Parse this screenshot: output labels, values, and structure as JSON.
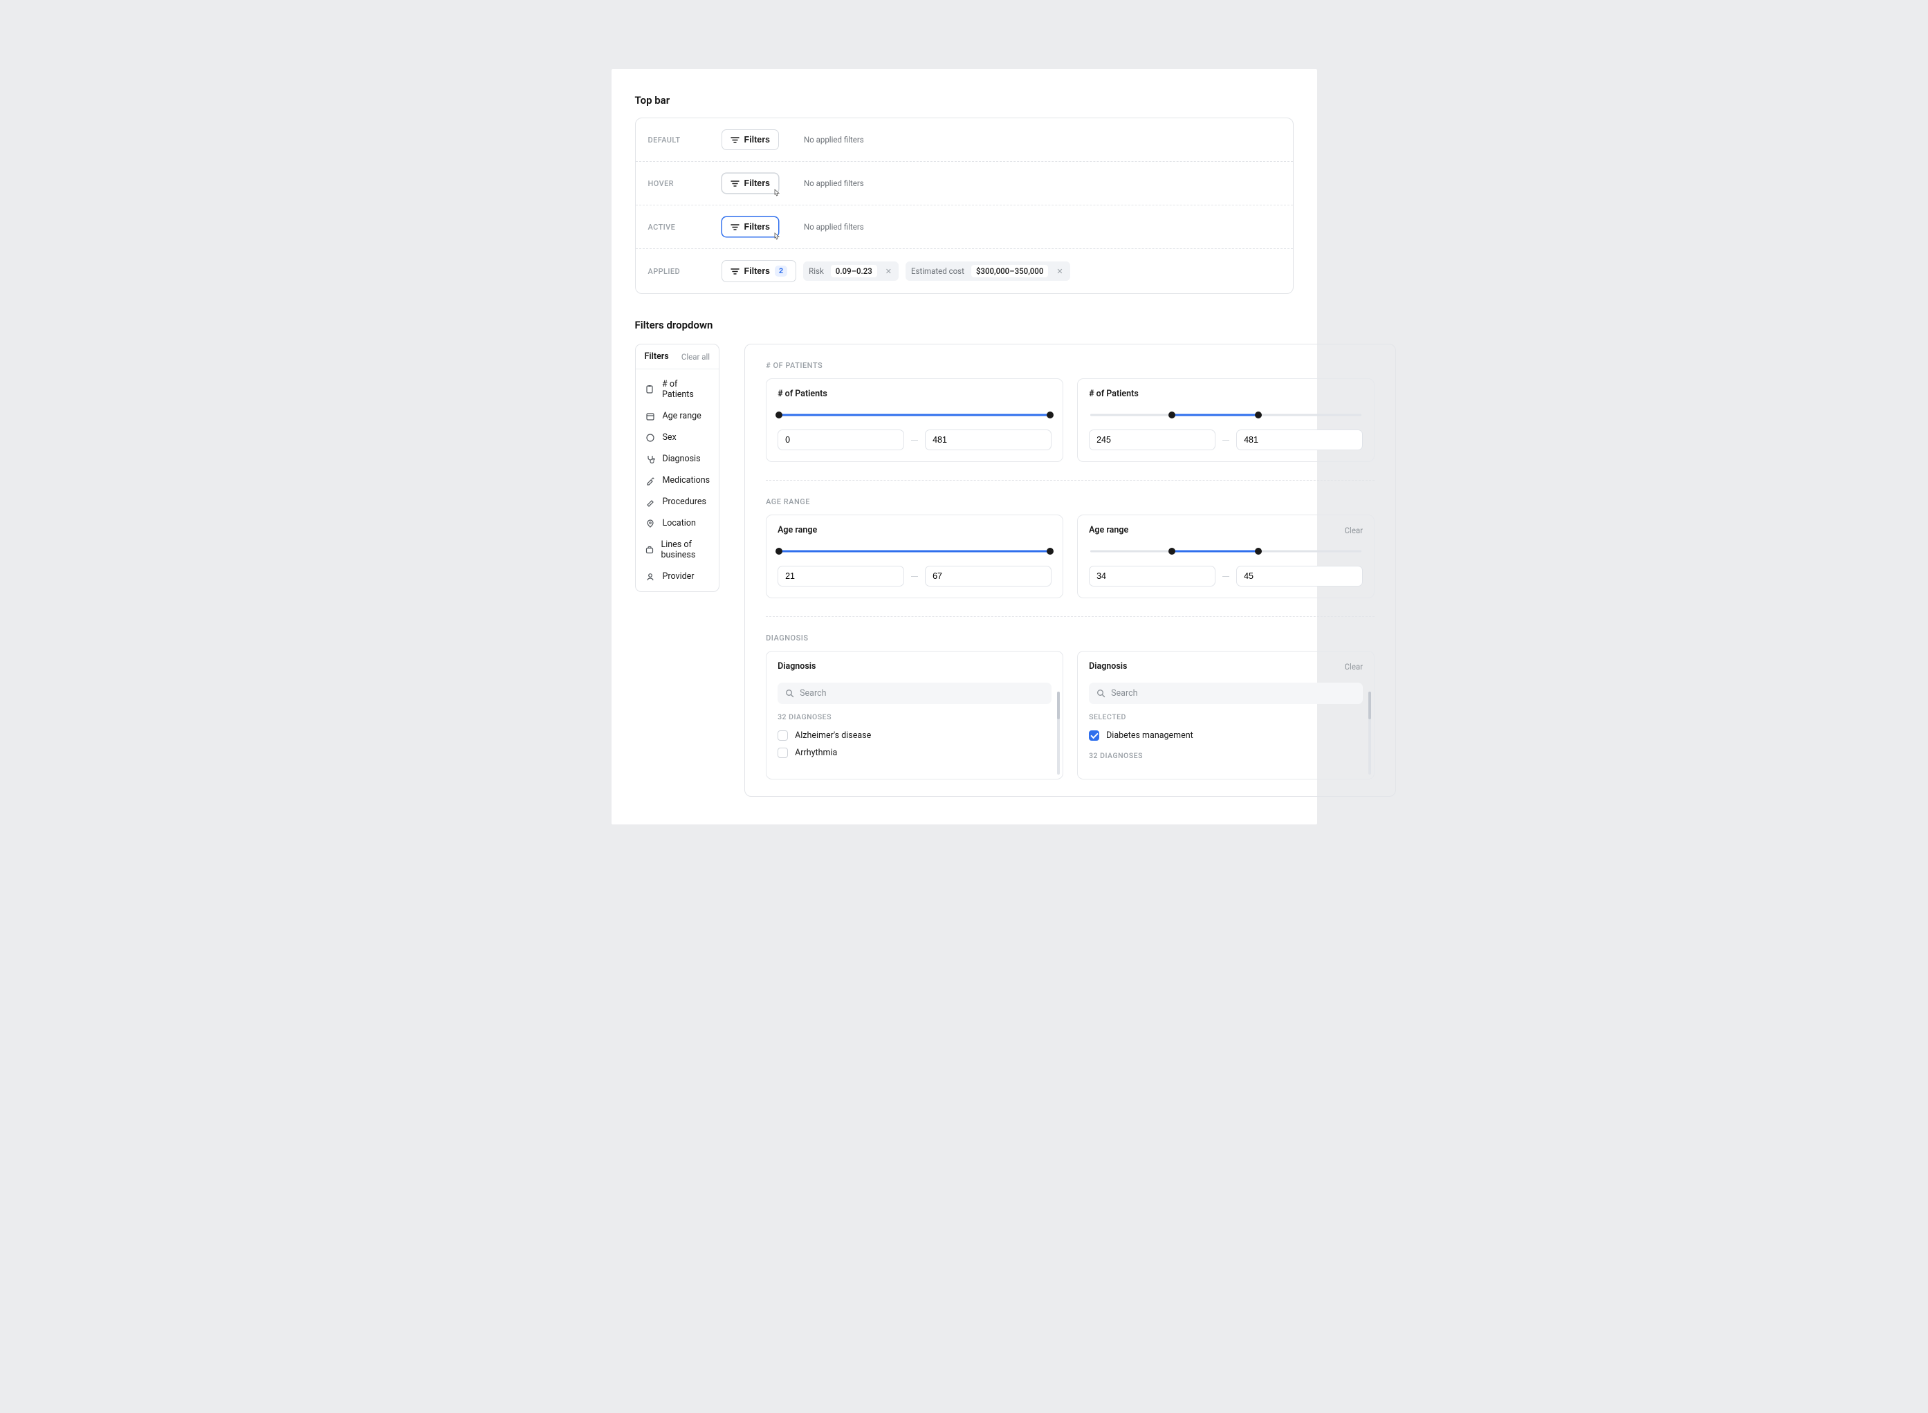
{
  "section_topbar_title": "Top bar",
  "section_dropdown_title": "Filters dropdown",
  "states": {
    "default": "DEFAULT",
    "hover": "HOVER",
    "active": "ACTIVE",
    "applied": "APPLIED"
  },
  "filters_button_label": "Filters",
  "no_applied": "No applied filters",
  "applied_count": "2",
  "chip_risk_label": "Risk",
  "chip_risk_value": "0.09–0.23",
  "chip_cost_label": "Estimated cost",
  "chip_cost_value": "$300,000–350,000",
  "dropdown": {
    "title": "Filters",
    "clear_all": "Clear all",
    "items": [
      "# of Patients",
      "Age range",
      "Sex",
      "Diagnosis",
      "Medications",
      "Procedures",
      "Location",
      "Lines of business",
      "Provider"
    ]
  },
  "panels": {
    "patients_head": "# OF PATIENTS",
    "age_head": "AGE RANGE",
    "diag_head": "DIAGNOSIS"
  },
  "patients": {
    "title": "# of Patients",
    "a_min": "0",
    "a_max": "481",
    "b_min": "245",
    "b_max": "481"
  },
  "age": {
    "title": "Age range",
    "clear": "Clear",
    "a_min": "21",
    "a_max": "67",
    "b_min": "34",
    "b_max": "45"
  },
  "diagnosis": {
    "title": "Diagnosis",
    "clear": "Clear",
    "search_placeholder": "Search",
    "count_head": "32 DIAGNOSES",
    "selected_head": "SELECTED",
    "items_left": [
      "Alzheimer's disease",
      "Arrhythmia"
    ],
    "selected_item": "Diabetes management"
  }
}
